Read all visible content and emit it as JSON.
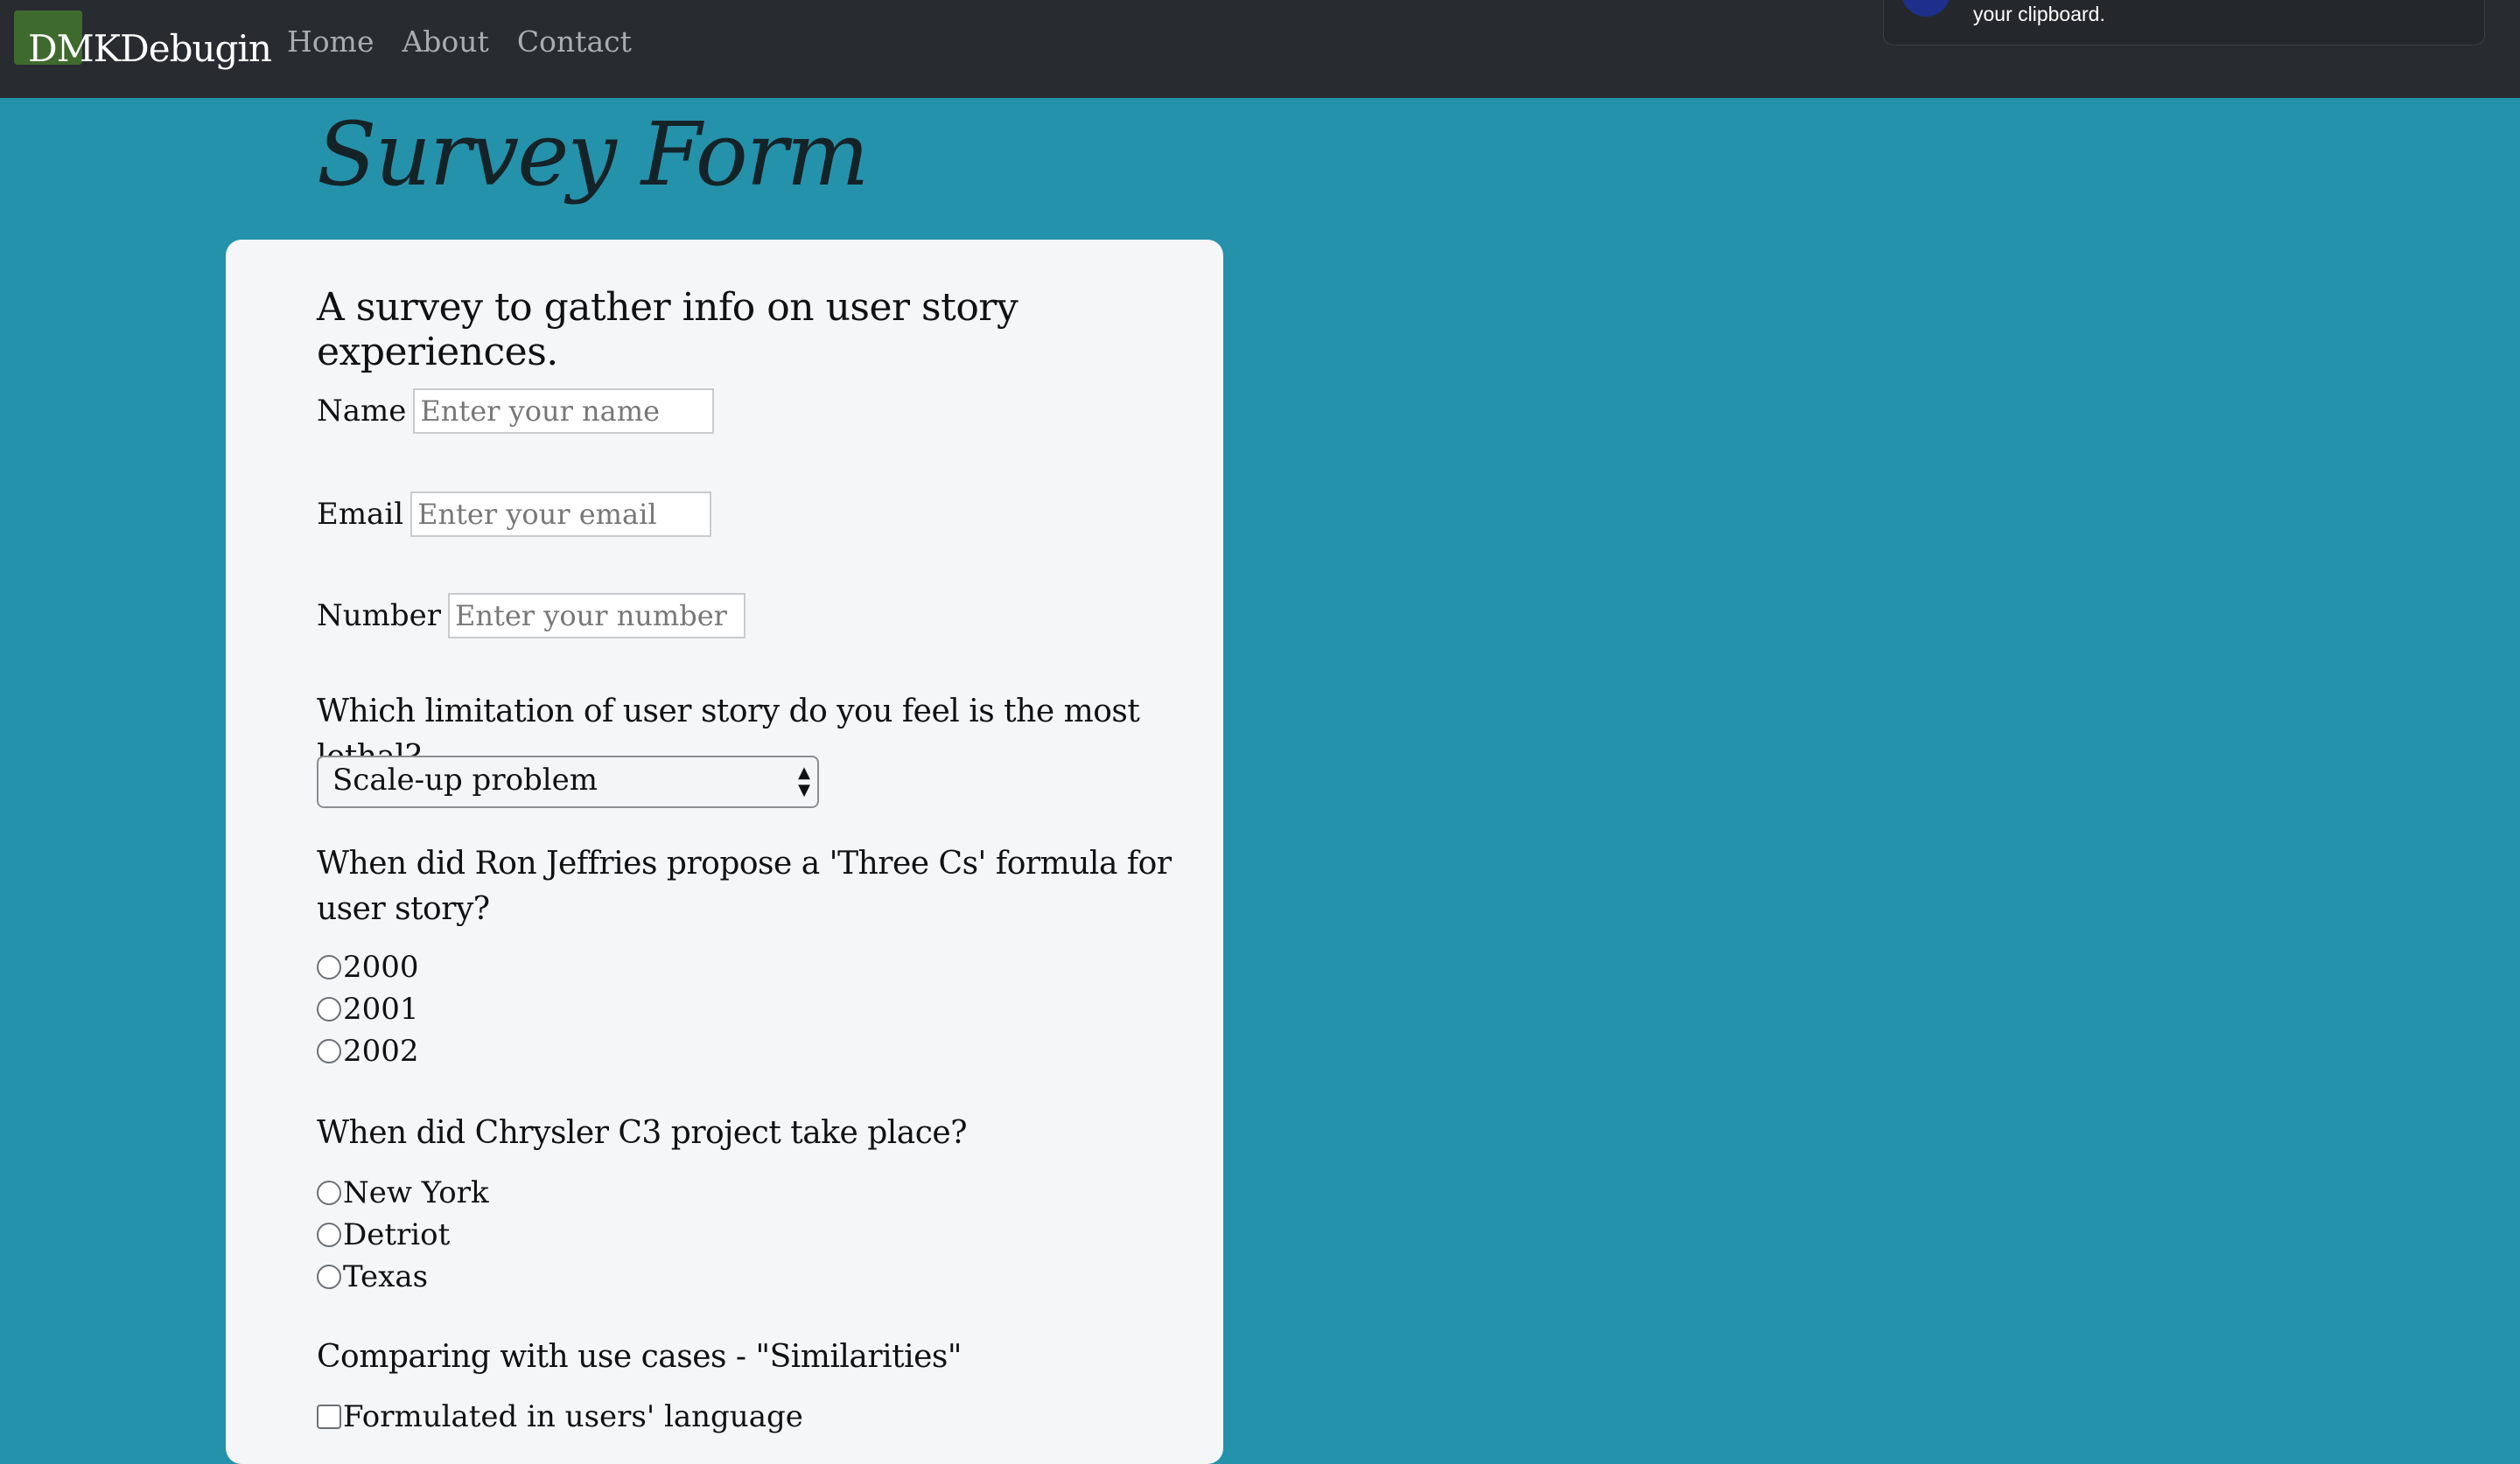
{
  "navbar": {
    "brand": "DMKDebugin",
    "links": [
      "Home",
      "About",
      "Contact"
    ]
  },
  "toast": {
    "text": "your clipboard."
  },
  "page": {
    "title": "Survey Form"
  },
  "form": {
    "description": "A survey to gather info on user story experiences.",
    "name": {
      "label": "Name",
      "placeholder": "Enter your name",
      "value": ""
    },
    "email": {
      "label": "Email",
      "placeholder": "Enter your email",
      "value": ""
    },
    "number": {
      "label": "Number",
      "placeholder": "Enter your number",
      "value": ""
    },
    "q1": {
      "question": "Which limitation of user story do you feel is the most lethal?",
      "selected": "Scale-up problem"
    },
    "q2": {
      "question": "When did Ron Jeffries propose a 'Three Cs' formula for user story?",
      "options": [
        "2000",
        "2001",
        "2002"
      ]
    },
    "q3": {
      "question": "When did Chrysler C3 project take place?",
      "options": [
        "New York",
        "Detriot",
        "Texas"
      ]
    },
    "q4": {
      "question": "Comparing with use cases - \"Similarities\"",
      "options": [
        "Formulated in users' language"
      ]
    }
  },
  "colors": {
    "page_bg": "#2592ab",
    "navbar_bg": "#282c31",
    "card_bg": "#f5f6f8"
  }
}
